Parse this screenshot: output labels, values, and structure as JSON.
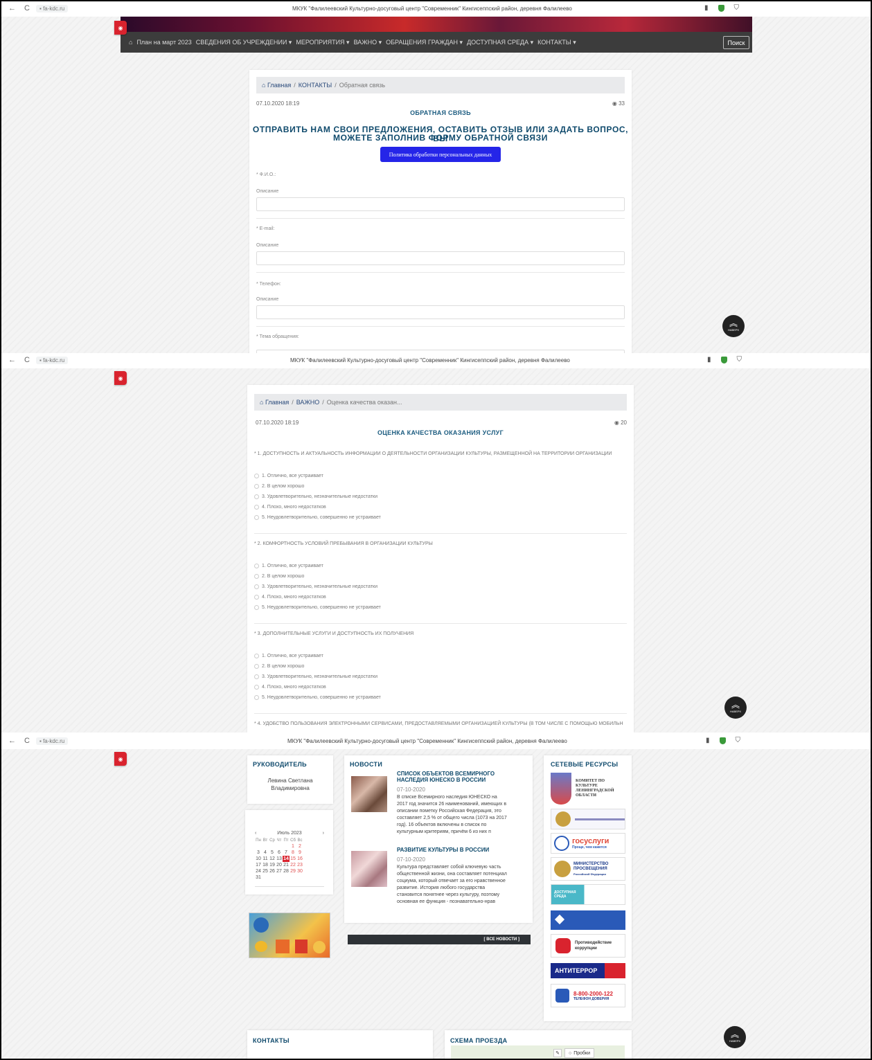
{
  "browser": {
    "url": "fa-kdc.ru",
    "page_title": "МКУК \"Фалилеевский Культурно-досуговый центр \"Современник\" Кингисеппский район, деревня Фалилеево"
  },
  "icons": {
    "back": "←",
    "reload": "C",
    "lock": "🔒",
    "bookmark": "▮",
    "extension": "⛉",
    "eye": "◉",
    "home": "⌂",
    "up": "︽"
  },
  "navbar": {
    "items": [
      "План на март 2023",
      "СВЕДЕНИЯ ОБ УЧРЕЖДЕНИИ ▾",
      "МЕРОПРИЯТИЯ ▾",
      "ВАЖНО ▾",
      "ОБРАЩЕНИЯ ГРАЖДАН ▾",
      "ДОСТУПНАЯ СРЕДА ▾",
      "КОНТАКТЫ ▾"
    ],
    "search": "Поиск"
  },
  "feedback": {
    "breadcrumb": {
      "home": "Главная",
      "section": "КОНТАКТЫ",
      "current": "Обратная связь"
    },
    "date": "07.10.2020 18:19",
    "views": "33",
    "small_title": "ОБРАТНАЯ СВЯЗЬ",
    "big_title_1": "ОТПРАВИТЬ НАМ СВОИ ПРЕДЛОЖЕНИЯ, ОСТАВИТЬ ОТЗЫВ ИЛИ ЗАДАТЬ ВОПРОС, ВЫ",
    "big_title_2": "МОЖЕТЕ ЗАПОЛНИВ ФОРМУ ОБРАТНОЙ СВЯЗИ",
    "policy_button": "Политика обработки персональных данных",
    "fields": [
      {
        "label": "* Ф.И.О.:",
        "desc": "Описание"
      },
      {
        "label": "* E-mail:",
        "desc": "Описание"
      },
      {
        "label": "* Телефон:",
        "desc": "Описание"
      },
      {
        "label": "* Тема обращения:"
      }
    ]
  },
  "survey": {
    "breadcrumb": {
      "home": "Главная",
      "section": "ВАЖНО",
      "current": "Оценка качества оказан..."
    },
    "date": "07.10.2020 18:19",
    "views": "20",
    "title": "ОЦЕНКА КАЧЕСТВА ОКАЗАНИЯ УСЛУГ",
    "questions": [
      "* 1. ДОСТУПНОСТЬ И АКТУАЛЬНОСТЬ ИНФОРМАЦИИ О ДЕЯТЕЛЬНОСТИ ОРГАНИЗАЦИИ КУЛЬТУРЫ, РАЗМЕЩЕННОЙ НА ТЕРРИТОРИИ ОРГАНИЗАЦИИ",
      "* 2. КОМФОРТНОСТЬ УСЛОВИЙ ПРЕБЫВАНИЯ В ОРГАНИЗАЦИИ КУЛЬТУРЫ",
      "* 3. ДОПОЛНИТЕЛЬНЫЕ УСЛУГИ И ДОСТУПНОСТЬ ИХ ПОЛУЧЕНИЯ",
      "* 4. УДОБСТВО ПОЛЬЗОВАНИЯ ЭЛЕКТРОННЫМИ СЕРВИСАМИ, ПРЕДОСТАВЛЯЕМЫМИ ОРГАНИЗАЦИЕЙ КУЛЬТУРЫ (В ТОМ ЧИСЛЕ С ПОМОЩЬЮ МОБИЛЬН"
    ],
    "options": [
      "1. Отлично, все устраивает",
      "2. В целом хорошо",
      "3. Удовлетворительно, незначительные недостатки",
      "4. Плохо, много недостатков",
      "5. Неудовлетворительно, совершенно не устраивает"
    ]
  },
  "sidebar": {
    "director_title": "РУКОВОДИТЕЛЬ",
    "director_name_1": "Левина Светлана",
    "director_name_2": "Владимировна",
    "calendar": {
      "month": "Июль 2023",
      "prev": "‹",
      "next": "›",
      "days": [
        "Пн",
        "Вт",
        "Ср",
        "Чт",
        "Пт",
        "Сб",
        "Вс"
      ],
      "weeks": [
        [
          "",
          "",
          "",
          "",
          "",
          "1",
          "2"
        ],
        [
          "3",
          "4",
          "5",
          "6",
          "7",
          "8",
          "9"
        ],
        [
          "10",
          "11",
          "12",
          "13",
          "14",
          "15",
          "16"
        ],
        [
          "17",
          "18",
          "19",
          "20",
          "21",
          "22",
          "23"
        ],
        [
          "24",
          "25",
          "26",
          "27",
          "28",
          "29",
          "30"
        ],
        [
          "31",
          "",
          "",
          "",
          "",
          "",
          ""
        ]
      ],
      "today": "14"
    }
  },
  "news": {
    "title": "НОВОСТИ",
    "items": [
      {
        "title_1": "СПИСОК ОБЪЕКТОВ ВСЕМИРНОГО",
        "title_2": "НАСЛЕДИЯ ЮНЕСКО В РОССИИ",
        "date": "07-10-2020",
        "body": [
          "В списке Всемирного наследия ЮНЕСКО на",
          "2017 год значится 26 наименований, имеющих в",
          "описании пометку Российская Федерация, это",
          "составляет 2,5 % от общего числа (1073 на 2017",
          "год). 16 объектов включены в список по",
          "культурным критериям, причём 6 из них п"
        ]
      },
      {
        "title_1": "РАЗВИТИЕ КУЛЬТУРЫ В РОССИИ",
        "title_2": "",
        "date": "07-10-2020",
        "body": [
          "Культура представляет собой ключевую часть",
          "общественной жизни, она составляет потенциал",
          "социума, который отвечает за его нравственное",
          "развитие. История любого государства",
          "становится понятнее через культуру, поэтому",
          "основная ее функция - познавательно-нрав"
        ]
      }
    ],
    "all_news": "[ ВСЕ НОВОСТИ ]"
  },
  "resources": {
    "title": "СЕТЕВЫЕ РЕСУРСЫ",
    "committee_1": "КОМИТЕТ ПО",
    "committee_2": "КУЛЬТУРЕ",
    "committee_3": "ЛЕНИНГРАДСКОЙ",
    "committee_4": "ОБЛАСТИ",
    "gosuslugi": "госуслуги",
    "gosuslugi_sub": "Проще, чем кажется",
    "minpros_1": "МИНИСТЕРСТВО",
    "minpros_2": "ПРОСВЕЩЕНИЯ",
    "minpros_3": "Российской Федерации",
    "dostup": "ДОСТУПНАЯ СРЕДА",
    "anticor_1": "Противодействие",
    "anticor_2": "коррупции",
    "antiterror": "АНТИТЕРРОР",
    "phone": "8-800-2000-122",
    "phone_sub": "ТЕЛЕФОН ДОВЕРИЯ"
  },
  "footer": {
    "contacts_title": "КОНТАКТЫ",
    "map_title": "СХЕМА ПРОЕЗДА",
    "traffic": "Пробки"
  },
  "scroll_up_label": "НАВЕРХ"
}
